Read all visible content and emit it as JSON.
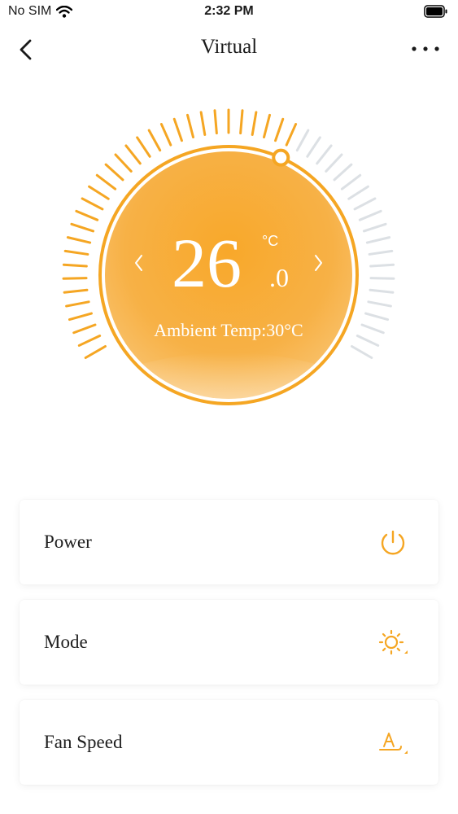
{
  "status_bar": {
    "carrier": "No SIM",
    "time": "2:32 PM",
    "wifi_icon": "wifi-icon",
    "battery_icon": "battery-icon"
  },
  "nav": {
    "title": "Virtual",
    "back_icon": "chevron-left-icon",
    "more_icon": "more-horizontal-icon"
  },
  "thermostat": {
    "set_temp_integer": "26",
    "set_temp_decimal": ".0",
    "unit": "°C",
    "ambient_label": "Ambient Temp:30°C",
    "level": 0.6,
    "accent_color": "#F5A623",
    "inactive_tick_color": "#DCE0E4"
  },
  "controls": [
    {
      "label": "Power",
      "icon": "power-icon"
    },
    {
      "label": "Mode",
      "icon": "sun-icon"
    },
    {
      "label": "Fan Speed",
      "icon": "fan-speed-auto-icon"
    }
  ]
}
